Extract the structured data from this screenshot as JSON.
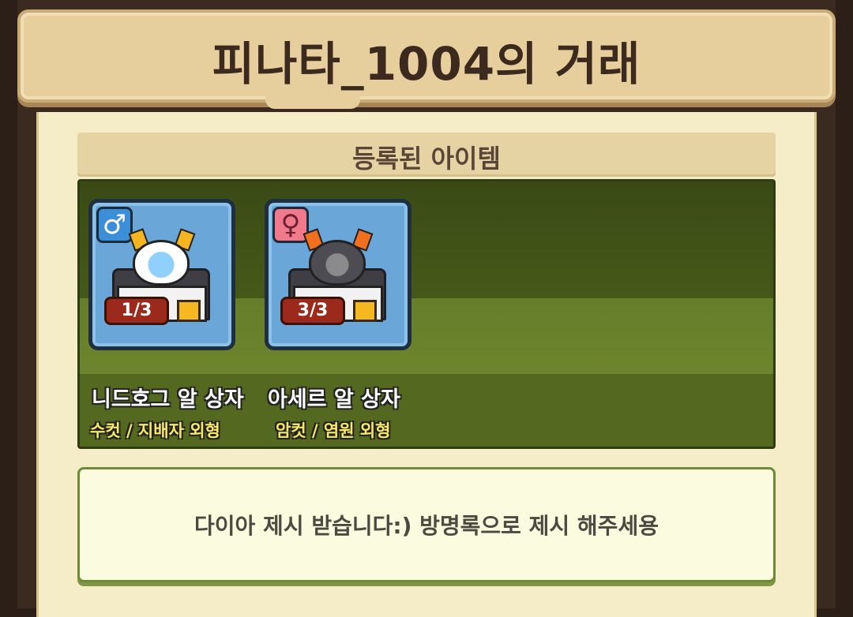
{
  "window": {
    "title": "피나타_1004의 거래"
  },
  "section": {
    "title": "등록된 아이템"
  },
  "items": [
    {
      "name": "니드호그 알 상자",
      "subtitle": "수컷 / 지배자 외형",
      "count": "1/3",
      "gender_icon": "♂",
      "gender": "male",
      "icon": "white-egg-nest-icon"
    },
    {
      "name": "아세르 알 상자",
      "subtitle": "암컷 / 염원 외형",
      "count": "3/3",
      "gender_icon": "♀",
      "gender": "female",
      "icon": "dark-egg-nest-icon"
    }
  ],
  "message": "다이아 제시 받습니다:) 방명록으로 제시 해주세용",
  "colors": {
    "card": "#6aa6d8",
    "male": "#3a8fd8",
    "female": "#f07a8c",
    "count_pill": "#9c2a1c"
  }
}
